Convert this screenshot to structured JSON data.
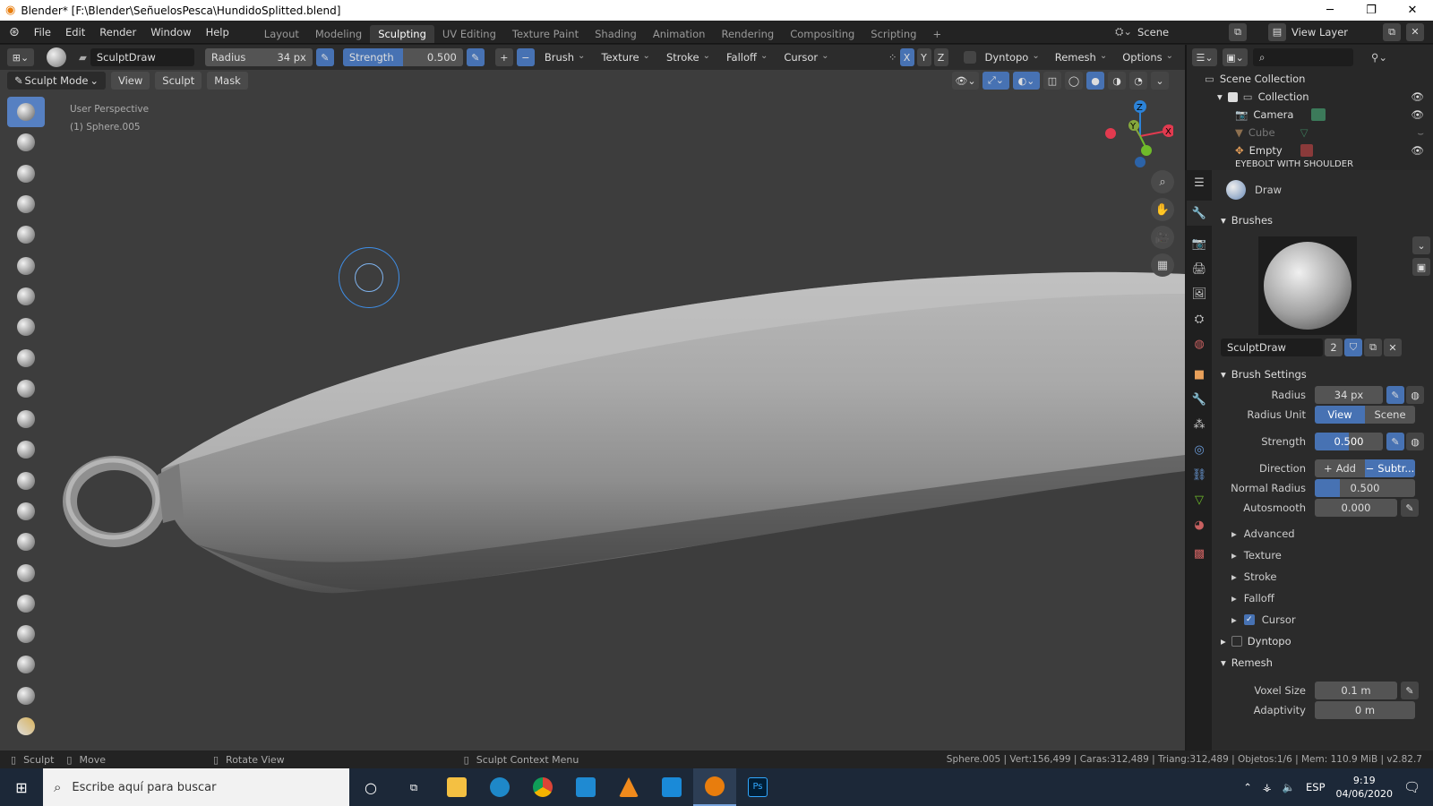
{
  "window": {
    "title": "Blender* [F:\\Blender\\SeñuelosPesca\\HundidoSplitted.blend]"
  },
  "menu": [
    "File",
    "Edit",
    "Render",
    "Window",
    "Help"
  ],
  "workspaces": [
    "Layout",
    "Modeling",
    "Sculpting",
    "UV Editing",
    "Texture Paint",
    "Shading",
    "Animation",
    "Rendering",
    "Compositing",
    "Scripting"
  ],
  "active_workspace": "Sculpting",
  "scene": {
    "label": "Scene",
    "view_layer": "View Layer"
  },
  "tool_header": {
    "brush_name": "SculptDraw",
    "radius_label": "Radius",
    "radius_value": "34 px",
    "strength_label": "Strength",
    "strength_value": "0.500",
    "dropdowns": [
      "Brush",
      "Texture",
      "Stroke",
      "Falloff",
      "Cursor"
    ],
    "axes": [
      "X",
      "Y",
      "Z"
    ],
    "dyntopo": "Dyntopo",
    "remesh": "Remesh",
    "options": "Options"
  },
  "viewport": {
    "mode": "Sculpt Mode",
    "buttons": [
      "View",
      "Sculpt",
      "Mask"
    ],
    "info_line1": "User Perspective",
    "info_line2": "(1) Sphere.005"
  },
  "outliner": {
    "root": "Scene Collection",
    "collection": "Collection",
    "items": [
      "Camera",
      "Cube",
      "Empty",
      "EYEBOLT WITH SHOULDER"
    ]
  },
  "properties": {
    "tool_name": "Draw",
    "brushes_header": "Brushes",
    "brush_name": "SculptDraw",
    "brush_users": "2",
    "brush_settings_header": "Brush Settings",
    "radius_label": "Radius",
    "radius_value": "34 px",
    "radius_unit_label": "Radius Unit",
    "radius_unit_view": "View",
    "radius_unit_scene": "Scene",
    "strength_label": "Strength",
    "strength_value": "0.500",
    "direction_label": "Direction",
    "direction_add": "Add",
    "direction_subtract": "Subtr...",
    "normal_radius_label": "Normal Radius",
    "normal_radius_value": "0.500",
    "autosmooth_label": "Autosmooth",
    "autosmooth_value": "0.000",
    "subpanels": [
      "Advanced",
      "Texture",
      "Stroke",
      "Falloff",
      "Cursor"
    ],
    "dyntopo_header": "Dyntopo",
    "remesh_header": "Remesh",
    "voxel_size_label": "Voxel Size",
    "voxel_size_value": "0.1 m",
    "adaptivity_label": "Adaptivity",
    "adaptivity_value": "0 m"
  },
  "statusbar": {
    "sculpt": "Sculpt",
    "move": "Move",
    "rotate": "Rotate View",
    "context": "Sculpt Context Menu",
    "stats": "Sphere.005 | Vert:156,499 | Caras:312,489 | Triang:312,489 | Objetos:1/6 | Mem: 110.9 MiB | v2.82.7"
  },
  "taskbar": {
    "search_placeholder": "Escribe aquí para buscar",
    "lang": "ESP",
    "time": "9:19",
    "date": "04/06/2020"
  },
  "colors": {
    "accent": "#4772b3",
    "viewport_bg": "#3d3d3d",
    "panel_bg": "#2b2b2b"
  }
}
